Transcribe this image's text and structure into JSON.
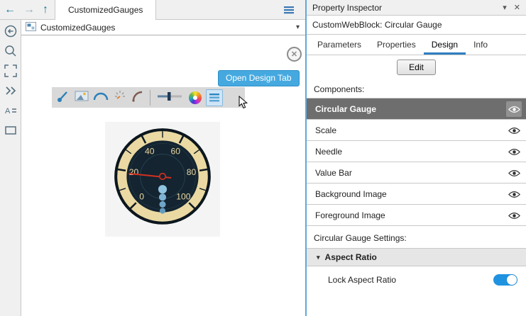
{
  "icons": {
    "back": "←",
    "forward": "→",
    "up": "↑",
    "dropdown": "▾",
    "panel_menu": "▾",
    "close": "✕",
    "canvas_close": "✕",
    "section_triangle": "▾"
  },
  "colors": {
    "accent_blue": "#2e86c1",
    "splitter_blue": "#5fa8d8",
    "toggle_on": "#1f93e0",
    "selected_row_bg": "#6e6e6e",
    "tooltip_bg": "#45a9e0",
    "gauge_face": "#142430",
    "gauge_ring": "#ead9a2",
    "needle_red": "#d2301f"
  },
  "topbar": {
    "tab_title": "CustomizedGauges"
  },
  "address_bar": {
    "text": "CustomizedGauges"
  },
  "canvas": {
    "tooltip": "Open Design Tab",
    "gauge_labels": [
      "0",
      "20",
      "40",
      "60",
      "80",
      "100"
    ]
  },
  "inspector": {
    "title": "Property Inspector",
    "block_heading": "CustomWebBlock: Circular Gauge",
    "tabs": [
      "Parameters",
      "Properties",
      "Design",
      "Info"
    ],
    "active_tab": "Design",
    "edit_button": "Edit",
    "components_label": "Components:",
    "components": [
      {
        "name": "Circular Gauge",
        "selected": true
      },
      {
        "name": "Scale",
        "selected": false
      },
      {
        "name": "Needle",
        "selected": false
      },
      {
        "name": "Value Bar",
        "selected": false
      },
      {
        "name": "Background Image",
        "selected": false
      },
      {
        "name": "Foreground Image",
        "selected": false
      }
    ],
    "settings_label": "Circular Gauge Settings:",
    "aspect_section_title": "Aspect Ratio",
    "lock_label": "Lock Aspect Ratio",
    "lock_on": true
  }
}
